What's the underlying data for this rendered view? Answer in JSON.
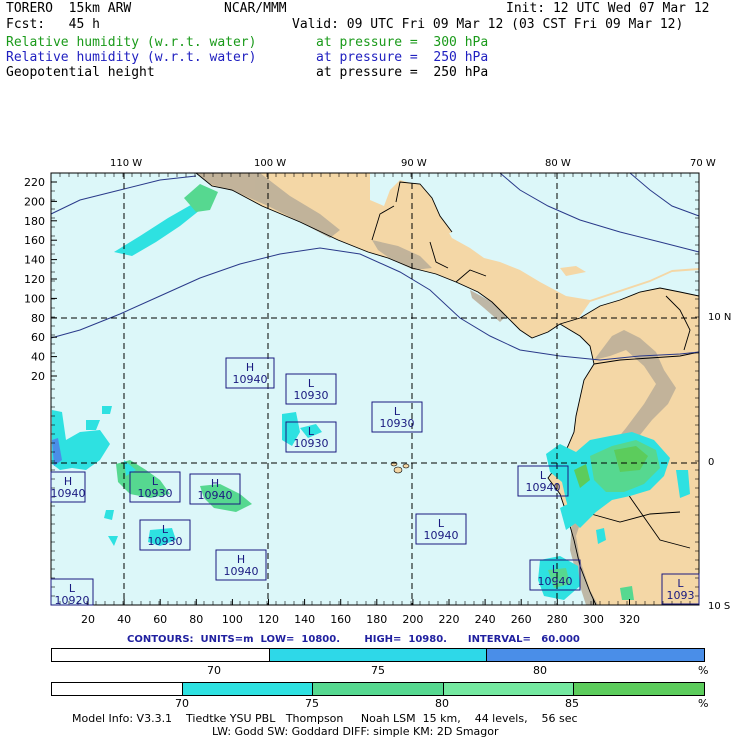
{
  "header": {
    "model": "TORERO  15km ARW",
    "org": "NCAR/MMM",
    "init": "Init: 12 UTC Wed 07 Mar 12",
    "fcst": "Fcst:   45 h",
    "valid": "Valid: 09 UTC Fri 09 Mar 12 (03 CST Fri 09 Mar 12)",
    "fields": [
      {
        "name": "Relative humidity (w.r.t. water)",
        "level": "at pressure =  300 hPa",
        "color": "#1a9a1a"
      },
      {
        "name": "Relative humidity (w.r.t. water)",
        "level": "at pressure =  250 hPa",
        "color": "#2020c0"
      },
      {
        "name": "Geopotential height",
        "level": "at pressure =  250 hPa",
        "color": "#000000"
      }
    ]
  },
  "axes": {
    "top_lon_labels": [
      "110 W",
      "100 W",
      "90 W",
      "80 W",
      "70 W"
    ],
    "right_lat_labels": [
      "10 N",
      "0",
      "10 S"
    ],
    "left_ticks": [
      "220",
      "200",
      "180",
      "160",
      "140",
      "120",
      "100",
      "80",
      "60",
      "40",
      "20"
    ],
    "bottom_ticks": [
      "20",
      "40",
      "60",
      "80",
      "100",
      "120",
      "140",
      "160",
      "180",
      "200",
      "220",
      "240",
      "260",
      "280",
      "300",
      "320"
    ]
  },
  "map": {
    "colors": {
      "ocean": "#dcf7f9",
      "land": "#f4d7a6",
      "terrain": "#b9ad98",
      "rh_cyan": "#2ee1e1",
      "rh_green": "#56d890"
    },
    "centers": [
      {
        "type": "H",
        "value": "10940"
      },
      {
        "type": "L",
        "value": "10930"
      },
      {
        "type": "L",
        "value": "10930"
      },
      {
        "type": "L",
        "value": "10930"
      },
      {
        "type": "H",
        "value": "10940"
      },
      {
        "type": "L",
        "value": "10930"
      },
      {
        "type": "H",
        "value": "10940"
      },
      {
        "type": "L",
        "value": "10930"
      },
      {
        "type": "H",
        "value": "10940"
      },
      {
        "type": "L",
        "value": "10940"
      },
      {
        "type": "L",
        "value": "10940"
      },
      {
        "type": "L",
        "value": "10920"
      },
      {
        "type": "L",
        "value": "10940"
      },
      {
        "type": "L",
        "value": "1093"
      }
    ]
  },
  "contours_text": "CONTOURS:  UNITS=m  LOW=  10800.       HIGH=  10980.      INTERVAL=   60.000",
  "colorbar1": {
    "labels": [
      "70",
      "75",
      "80"
    ],
    "unit": "%",
    "colors": [
      "#ffffff",
      "#2ed8e8",
      "#4a8ee8"
    ]
  },
  "colorbar2": {
    "labels": [
      "70",
      "75",
      "80",
      "85"
    ],
    "unit": "%",
    "colors": [
      "#ffffff",
      "#2ee1e1",
      "#56d890",
      "#74e8a0",
      "#5ccc5c"
    ]
  },
  "model_info": {
    "line1": "Model Info: V3.3.1    Tiedtke YSU PBL   Thompson     Noah LSM  15 km,    44 levels,    56 sec",
    "line2": "LW: Godd SW: Goddard DIFF: simple KM: 2D Smagor"
  }
}
